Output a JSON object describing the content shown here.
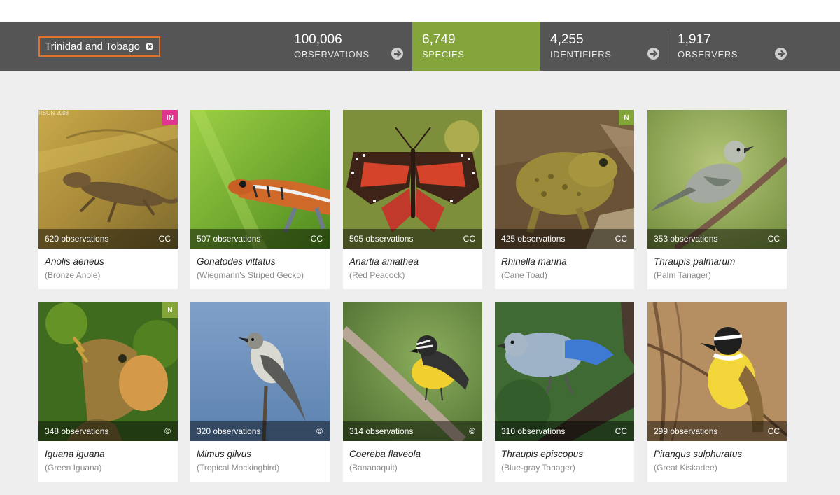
{
  "place_filter": {
    "label": "Trinidad and Tobago",
    "remove_icon": "close-circle-icon"
  },
  "stats": [
    {
      "value": "100,006",
      "label": "OBSERVATIONS",
      "icon": "arrow-right-circle-icon"
    },
    {
      "value": "6,749",
      "label": "SPECIES"
    },
    {
      "value": "4,255",
      "label": "IDENTIFIERS",
      "icon": "arrow-right-circle-icon"
    },
    {
      "value": "1,917",
      "label": "OBSERVERS",
      "icon": "arrow-right-circle-icon"
    }
  ],
  "colors": {
    "active_tab": "#83a53a",
    "introduced_badge": "#e0358f",
    "native_badge": "#83a53a",
    "filter_border": "#e0742c"
  },
  "species": [
    {
      "name": "Anolis aeneus",
      "common": "(Bronze Anole)",
      "observations": "620 observations",
      "license": "CC",
      "badge": "IN",
      "photo_caption": "RSON 2008"
    },
    {
      "name": "Gonatodes vittatus",
      "common": "(Wiegmann's Striped Gecko)",
      "observations": "507 observations",
      "license": "CC"
    },
    {
      "name": "Anartia amathea",
      "common": "(Red Peacock)",
      "observations": "505 observations",
      "license": "CC"
    },
    {
      "name": "Rhinella marina",
      "common": "(Cane Toad)",
      "observations": "425 observations",
      "license": "CC",
      "badge": "N"
    },
    {
      "name": "Thraupis palmarum",
      "common": "(Palm Tanager)",
      "observations": "353 observations",
      "license": "CC"
    },
    {
      "name": "Iguana iguana",
      "common": "(Green Iguana)",
      "observations": "348 observations",
      "license": "©",
      "badge": "N"
    },
    {
      "name": "Mimus gilvus",
      "common": "(Tropical Mockingbird)",
      "observations": "320 observations",
      "license": "©"
    },
    {
      "name": "Coereba flaveola",
      "common": "(Bananaquit)",
      "observations": "314 observations",
      "license": "©"
    },
    {
      "name": "Thraupis episcopus",
      "common": "(Blue-gray Tanager)",
      "observations": "310 observations",
      "license": "CC"
    },
    {
      "name": "Pitangus sulphuratus",
      "common": "(Great Kiskadee)",
      "observations": "299 observations",
      "license": "CC"
    }
  ]
}
